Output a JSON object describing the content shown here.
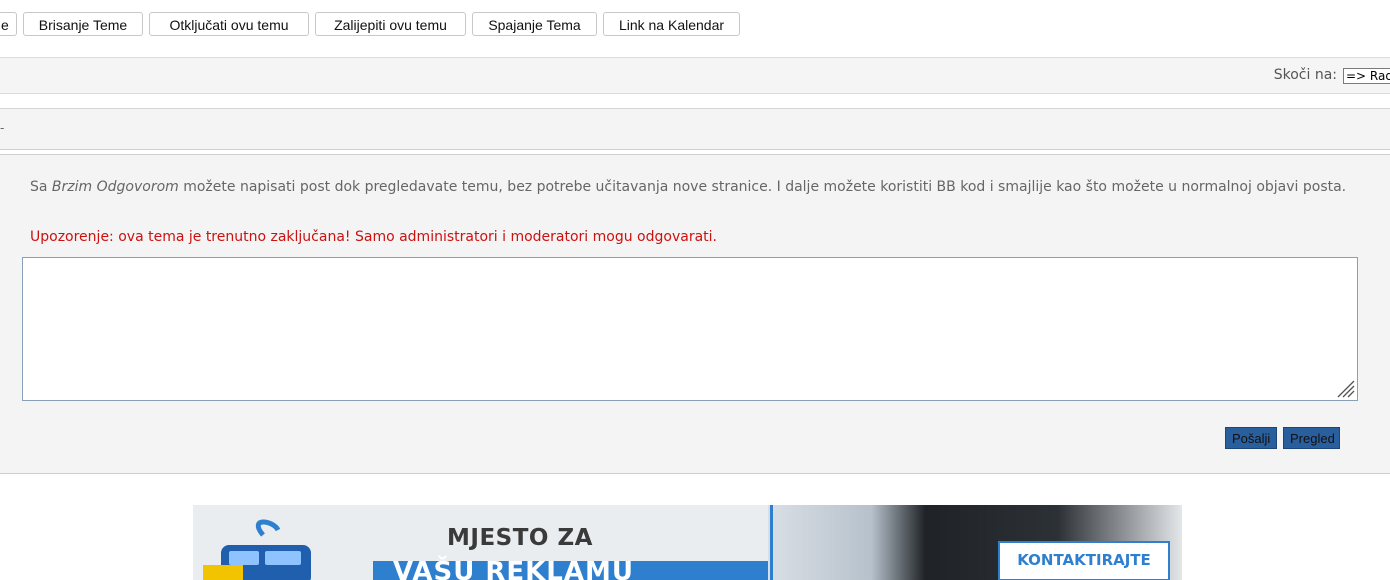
{
  "toolbar": {
    "buttons": [
      {
        "label": "e"
      },
      {
        "label": "Brisanje Teme"
      },
      {
        "label": "Otključati ovu temu"
      },
      {
        "label": "Zalijepiti ovu temu"
      },
      {
        "label": "Spajanje Tema"
      },
      {
        "label": "Link na Kalendar"
      }
    ]
  },
  "jump": {
    "label": "Skoči na:",
    "selected": "=> Rad"
  },
  "header": {
    "mark": "-"
  },
  "quick_reply": {
    "info_prefix": "Sa ",
    "info_em": "Brzim Odgovorom",
    "info_rest": " možete napisati post dok pregledavate temu, bez potrebe učitavanja nove stranice. I dalje možete koristiti BB kod i smajlije kao što možete u normalnoj objavi posta.",
    "warning": "Upozorenje: ova tema je trenutno zaključana! Samo administratori i moderatori mogu odgovarati.",
    "textarea_value": "",
    "send_label": "Pošalji",
    "preview_label": "Pregled"
  },
  "banner": {
    "headline": "MJESTO ZA",
    "strip_text": "VAŠU REKLAMU",
    "cta": "KONTAKTIRAJTE NAS"
  },
  "colors": {
    "warning": "#cc1111",
    "button_blue": "#2a5f9e",
    "accent_blue": "#2f7fcf"
  }
}
